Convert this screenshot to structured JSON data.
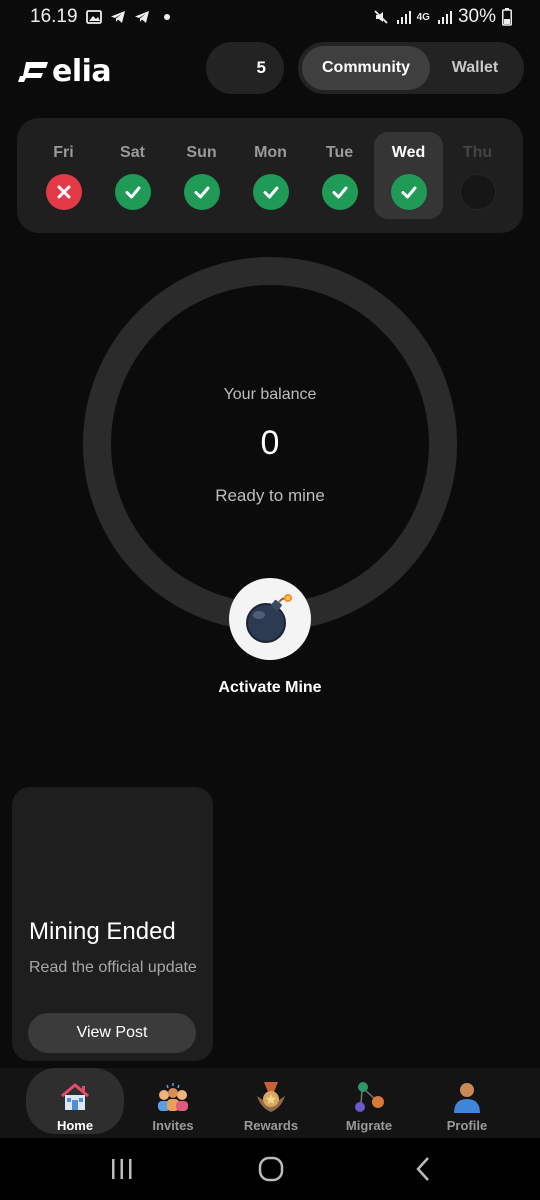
{
  "status_bar": {
    "time": "16.19",
    "battery": "30%",
    "network": "4G"
  },
  "header": {
    "logo_text": "elia",
    "count": "5",
    "tabs": [
      {
        "label": "Community",
        "active": true
      },
      {
        "label": "Wallet",
        "active": false
      }
    ]
  },
  "streak": {
    "days": [
      {
        "label": "Fri",
        "state": "missed"
      },
      {
        "label": "Sat",
        "state": "done"
      },
      {
        "label": "Sun",
        "state": "done"
      },
      {
        "label": "Mon",
        "state": "done"
      },
      {
        "label": "Tue",
        "state": "done"
      },
      {
        "label": "Wed",
        "state": "done",
        "selected": true
      },
      {
        "label": "Thu",
        "state": "upcoming"
      }
    ]
  },
  "balance": {
    "label": "Your balance",
    "value": "0",
    "status": "Ready to mine"
  },
  "mine": {
    "label": "Activate Mine",
    "icon": "bomb-icon"
  },
  "mining_card": {
    "title": "Mining Ended",
    "subtitle": "Read the official update",
    "button": "View Post"
  },
  "bottom_nav": [
    {
      "label": "Home",
      "icon": "home-icon",
      "active": true
    },
    {
      "label": "Invites",
      "icon": "people-icon",
      "active": false
    },
    {
      "label": "Rewards",
      "icon": "medal-icon",
      "active": false
    },
    {
      "label": "Migrate",
      "icon": "coins-icon",
      "active": false
    },
    {
      "label": "Profile",
      "icon": "person-icon",
      "active": false
    }
  ],
  "colors": {
    "success": "#1f9a57",
    "error": "#e23b47",
    "background": "#0b0b0b",
    "card": "#1f1f1f"
  }
}
